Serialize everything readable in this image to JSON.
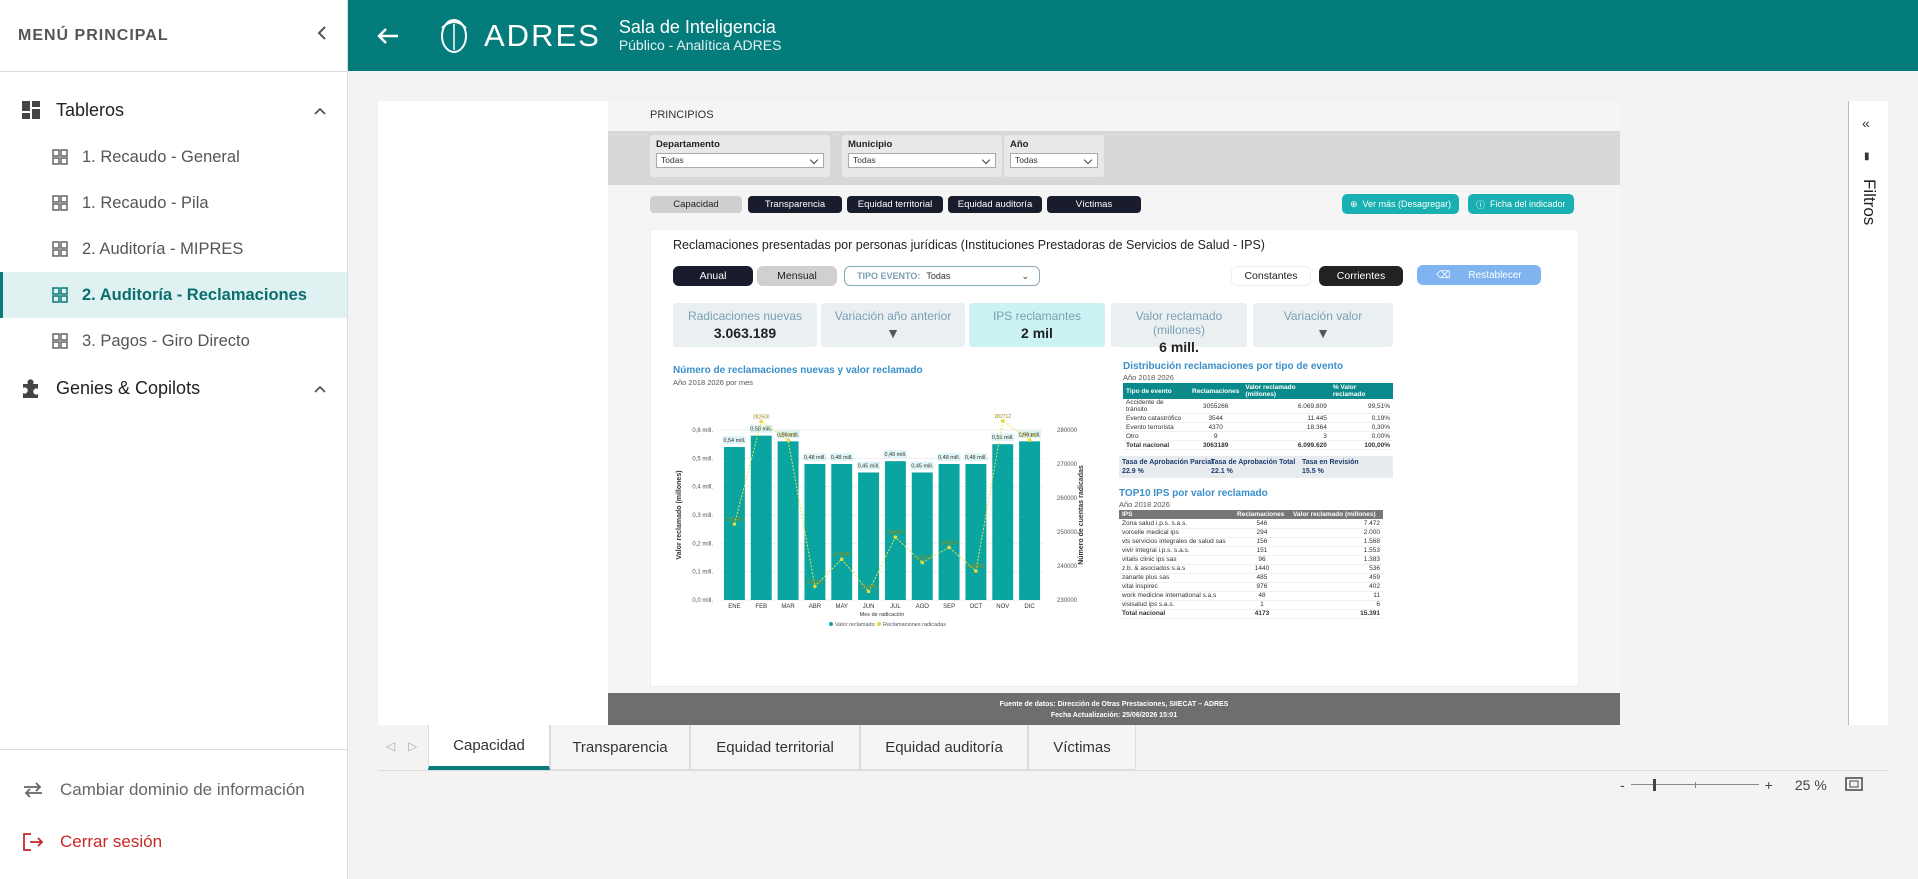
{
  "sidebar": {
    "title": "MENÚ PRINCIPAL",
    "section1": "Tableros",
    "items": [
      "1. Recaudo - General",
      "1. Recaudo - Pila",
      "2. Auditoría - MIPRES",
      "2. Auditoría - Reclamaciones",
      "3. Pagos - Giro Directo"
    ],
    "section2": "Genies & Copilots",
    "footer": {
      "change": "Cambiar dominio de información",
      "logout": "Cerrar sesión"
    }
  },
  "topbar": {
    "brand": "ADRES",
    "title": "Sala de Inteligencia",
    "subtitle": "Público - Analítica ADRES"
  },
  "report": {
    "principios": "PRINCIPIOS",
    "filters": [
      {
        "label": "Departamento",
        "value": "Todas"
      },
      {
        "label": "Municipio",
        "value": "Todas"
      },
      {
        "label": "Año",
        "value": "Todas"
      }
    ],
    "tabs": [
      "Capacidad",
      "Transparencia",
      "Equidad territorial",
      "Equidad auditoría",
      "Víctimas"
    ],
    "ver_mas": "Ver más (Desagregar)",
    "ficha": "Ficha del indicador",
    "card_title": "Reclamaciones presentadas por personas jurídicas (Instituciones Prestadoras de Servicios de Salud - IPS)",
    "anual": "Anual",
    "mensual": "Mensual",
    "tipo_evento_label": "TIPO EVENTO:",
    "tipo_evento_value": "Todas",
    "constantes": "Constantes",
    "corrientes": "Corrientes",
    "restablecer": "Restablecer",
    "kpis": [
      {
        "label": "Radicaciones nuevas",
        "value": "3.063.189"
      },
      {
        "label": "Variación año anterior",
        "value": "▼"
      },
      {
        "label": "IPS reclamantes",
        "value": "2 mil"
      },
      {
        "label": "Valor reclamado (millones)",
        "value": "6 mill."
      },
      {
        "label": "Variación valor",
        "value": "▼"
      }
    ],
    "chart_section": "Número de reclamaciones nuevas  y valor reclamado",
    "chart_sub": "Año 2018 2026 por mes",
    "dist_title": "Distribución reclamaciones por tipo de evento",
    "dist_sub": "Año 2018 2026",
    "dist_headers": [
      "Tipo de evento",
      "Reclamaciones",
      "Valor reclamado (millones)",
      "% Valor reclamado"
    ],
    "dist_rows": [
      [
        "Accidente de tránsito",
        "3055266",
        "6.069.809",
        "99,51%"
      ],
      [
        "Evento catastrófico",
        "3544",
        "11.445",
        "0,19%"
      ],
      [
        "Evento terrorista",
        "4370",
        "18.364",
        "0,30%"
      ],
      [
        "Otro",
        "9",
        "3",
        "0,00%"
      ]
    ],
    "dist_total": [
      "Total nacional",
      "3063189",
      "6.099.620",
      "100,00%"
    ],
    "tasas": [
      {
        "label": "Tasa de Aprobación Parcial",
        "value": "22.9 %"
      },
      {
        "label": "Tasa de Aprobación Total",
        "value": "22.1 %"
      },
      {
        "label": "Tasa en Revisión",
        "value": "15.5 %"
      }
    ],
    "top_title": "TOP10 IPS por valor reclamado",
    "top_sub": "Año 2018 2026",
    "top_headers": [
      "IPS",
      "Reclamaciones",
      "Valor reclamado (millones)"
    ],
    "top_rows": [
      [
        "Zona salud i.p.s. s.a.s.",
        "546",
        "7.472"
      ],
      [
        "vorcelle medical ips",
        "294",
        "2.000"
      ],
      [
        "vts servicios integrales de salud sas",
        "156",
        "1.568"
      ],
      [
        "vivir integral i.p.s. s.a.s.",
        "151",
        "1.553"
      ],
      [
        "vitalis clinic ips sas",
        "96",
        "1.383"
      ],
      [
        "z.b. & asociados s.a.s",
        "1440",
        "536"
      ],
      [
        "zanarte plus sas",
        "485",
        "459"
      ],
      [
        "vital inspirec",
        "976",
        "402"
      ],
      [
        "work medicine international s.a.s",
        "48",
        "11"
      ],
      [
        "visisalud ips s.a.s.",
        "1",
        "6"
      ]
    ],
    "top_total": [
      "Total nacional",
      "4173",
      "15.391"
    ],
    "footer1": "Fuente de datos: Dirección de Otras Prestaciones, SIIECAT – ADRES",
    "footer2": "Fecha Actualización: 25/06/2026 15:01"
  },
  "filters_panel": "Filtros",
  "page_tabs": [
    "Capacidad",
    "Transparencia",
    "Equidad territorial",
    "Equidad auditoría",
    "Víctimas"
  ],
  "zoom": {
    "value": "25 %",
    "minus": "-",
    "plus": "+"
  },
  "chart_data": {
    "type": "bar",
    "title": "Número de reclamaciones nuevas  y valor reclamado",
    "xlabel": "Mes de radicación",
    "ylabel": "Valor reclamado (millones)",
    "y2label": "Número de cuentas radicadas",
    "categories": [
      "ENE",
      "FEB",
      "MAR",
      "ABR",
      "MAY",
      "JUN",
      "JUL",
      "AGO",
      "SEP",
      "OCT",
      "NOV",
      "DIC"
    ],
    "bar_labels": [
      "0,54 mill.",
      "0,58 mill.",
      "0,56 mill.",
      "0,48 mill.",
      "0,48 mill.",
      "0,45 mill.",
      "0,49 mill.",
      "0,45 mill.",
      "0,48 mill.",
      "0,48 mill.",
      "0,55 mill.",
      "0,56 mill."
    ],
    "series": [
      {
        "name": "Valor reclamado",
        "values": [
          0.54,
          0.58,
          0.56,
          0.48,
          0.48,
          0.45,
          0.49,
          0.45,
          0.48,
          0.48,
          0.55,
          0.56
        ]
      },
      {
        "name": "Reclamaciones radicadas",
        "values": [
          252300,
          282500,
          277000,
          234000,
          242000,
          232500,
          248500,
          241000,
          245500,
          238500,
          282712,
          277000
        ]
      }
    ],
    "ylim": [
      0,
      0.6
    ],
    "y2lim": [
      230000,
      280000
    ],
    "yticks": [
      "0,0 mill.",
      "0,1 mill.",
      "0,2 mill.",
      "0,3 mill.",
      "0,4 mill.",
      "0,5 mill.",
      "0,6 mill."
    ],
    "y2ticks": [
      "230000",
      "240000",
      "250000",
      "260000",
      "270000",
      "280000"
    ],
    "line_labels": [
      "252300",
      "282500",
      "277000",
      "234000",
      "242000",
      "232500",
      "248500",
      "241000",
      "245500",
      "238500",
      "282712",
      "277000"
    ],
    "legend": [
      "Valor reclamado",
      "Reclamaciones radicadas"
    ]
  }
}
